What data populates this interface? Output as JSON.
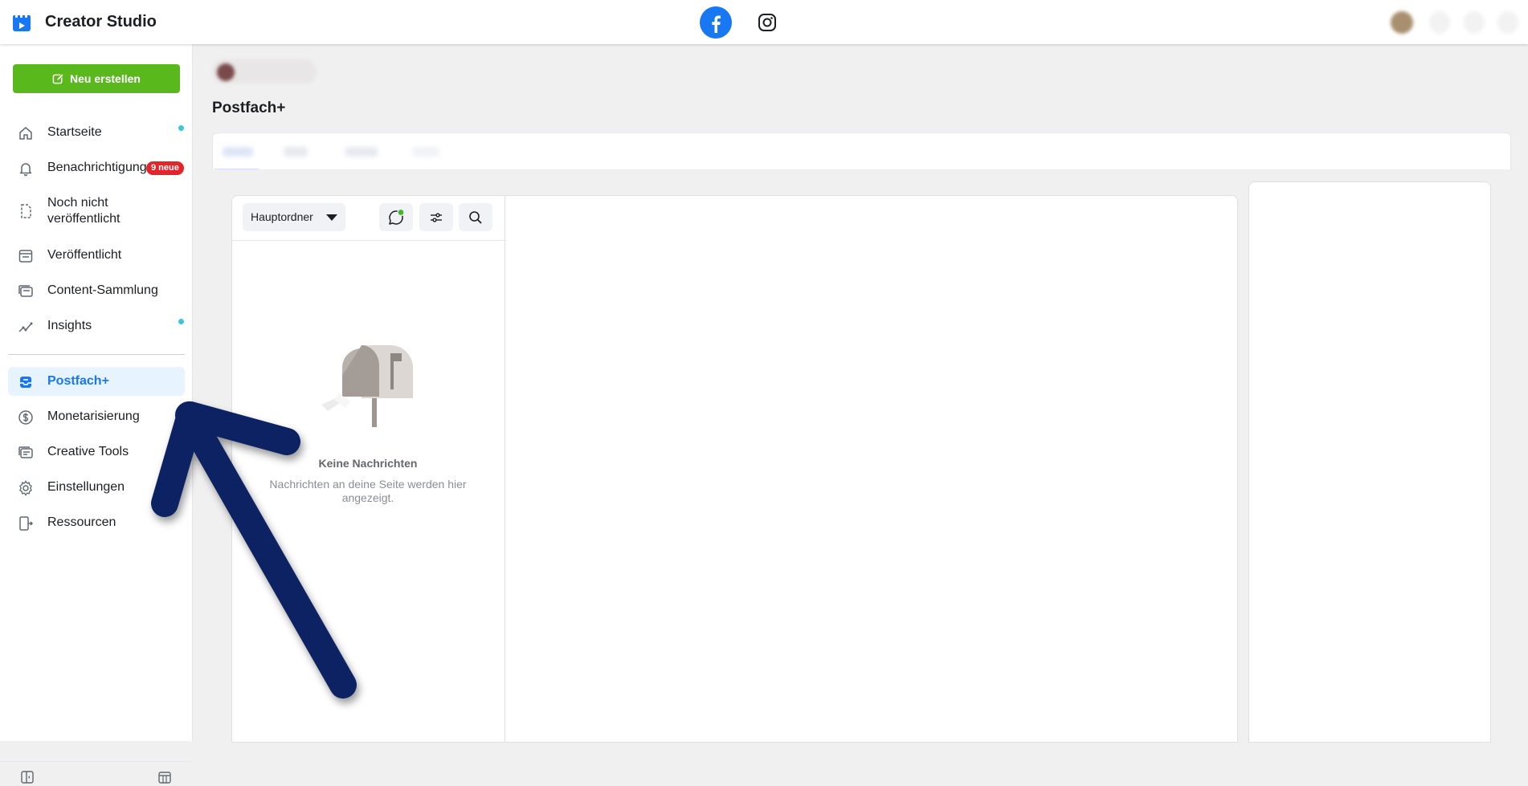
{
  "app": {
    "title": "Creator Studio"
  },
  "sidebar": {
    "create_button": "Neu erstellen",
    "items": [
      {
        "label": "Startseite",
        "icon": "home-icon"
      },
      {
        "label": "Benachrichtigung",
        "icon": "bell-icon",
        "badge": "9 neue"
      },
      {
        "label": "Noch nicht veröffentlicht",
        "icon": "draft-icon"
      },
      {
        "label": "Veröffentlicht",
        "icon": "published-icon"
      },
      {
        "label": "Content-Sammlung",
        "icon": "library-icon"
      },
      {
        "label": "Insights",
        "icon": "insights-icon"
      },
      {
        "label": "Postfach+",
        "icon": "inbox-icon",
        "active": true
      },
      {
        "label": "Monetarisierung",
        "icon": "dollar-icon"
      },
      {
        "label": "Creative Tools",
        "icon": "creative-tools-icon"
      },
      {
        "label": "Einstellungen",
        "icon": "gear-icon"
      },
      {
        "label": "Ressourcen",
        "icon": "resources-icon"
      }
    ]
  },
  "main": {
    "title": "Postfach+",
    "folder_select": "Hauptordner",
    "empty_state": {
      "title": "Keine Nachrichten",
      "subtitle": "Nachrichten an deine Seite werden hier angezeigt."
    }
  },
  "colors": {
    "accent": "#1877f2",
    "create_button": "#59b81c",
    "badge": "#e4242b",
    "annotation_arrow": "#0f2462"
  }
}
